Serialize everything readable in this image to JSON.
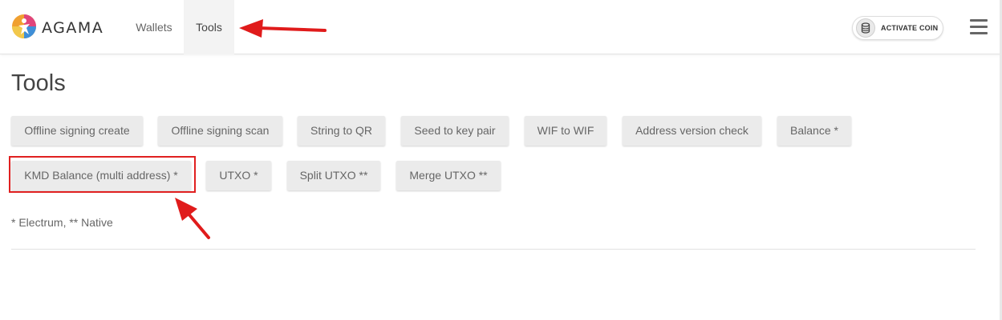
{
  "navbar": {
    "brand": "AGAMA",
    "links": [
      {
        "label": "Wallets",
        "active": false
      },
      {
        "label": "Tools",
        "active": true
      }
    ],
    "activate_coin_label": "ACTIVATE COIN"
  },
  "page": {
    "title": "Tools",
    "tools_row1": [
      "Offline signing create",
      "Offline signing scan",
      "String to QR",
      "Seed to key pair",
      "WIF to WIF",
      "Address version check",
      "Balance *"
    ],
    "tools_row2": [
      "KMD Balance (multi address) *",
      "UTXO *",
      "Split UTXO **",
      "Merge UTXO **"
    ],
    "footnote": "* Electrum, ** Native"
  },
  "annotations": {
    "color": "#e01b1b"
  }
}
